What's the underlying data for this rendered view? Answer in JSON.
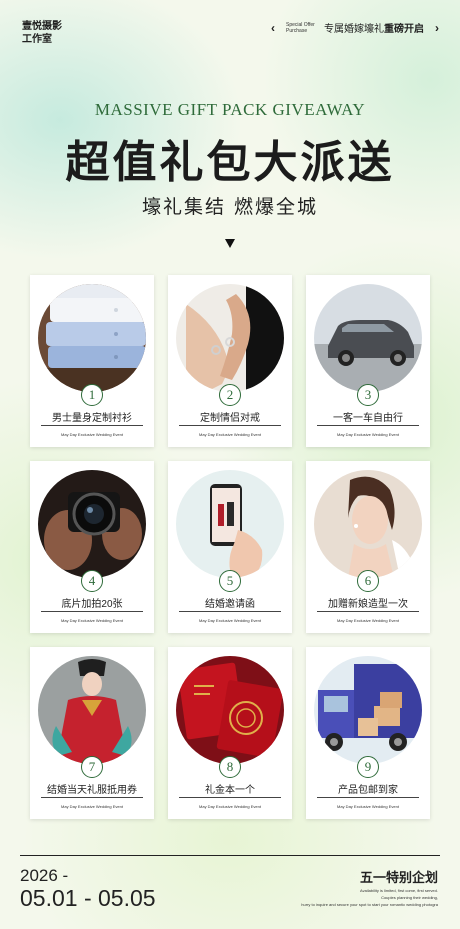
{
  "brand": {
    "line1": "壹悦摄影",
    "line2": "工作室"
  },
  "promo_bar": {
    "prev_icon": "chevron-left-icon",
    "small_line1": "Special Offer",
    "small_line2": "Purchase",
    "promo_prefix": "专属婚嫁壕礼",
    "promo_bold": "重磅开启",
    "next_icon": "chevron-right-icon"
  },
  "hero": {
    "subtitle_en": "MASSIVE GIFT PACK GIVEAWAY",
    "title": "超值礼包大派送",
    "tagline": "壕礼集结 燃爆全城"
  },
  "gifts": [
    {
      "num": "1",
      "label": "男士量身定制衬衫",
      "event": "May Day Exclusive Wedding Event",
      "photo": "folded-shirts"
    },
    {
      "num": "2",
      "label": "定制情侣对戒",
      "event": "May Day Exclusive Wedding Event",
      "photo": "couple-rings"
    },
    {
      "num": "3",
      "label": "一客一车自由行",
      "event": "May Day Exclusive Wedding Event",
      "photo": "suv-car"
    },
    {
      "num": "4",
      "label": "底片加拍20张",
      "event": "May Day Exclusive Wedding Event",
      "photo": "camera"
    },
    {
      "num": "5",
      "label": "结婚邀请函",
      "event": "May Day Exclusive Wedding Event",
      "photo": "phone-invitation"
    },
    {
      "num": "6",
      "label": "加赠新娘造型一次",
      "event": "May Day Exclusive Wedding Event",
      "photo": "bride-portrait"
    },
    {
      "num": "7",
      "label": "结婚当天礼服抵用券",
      "event": "May Day Exclusive Wedding Event",
      "photo": "red-wedding-gown"
    },
    {
      "num": "8",
      "label": "礼金本一个",
      "event": "May Day Exclusive Wedding Event",
      "photo": "red-gift-book"
    },
    {
      "num": "9",
      "label": "产品包邮到家",
      "event": "May Day Exclusive Wedding Event",
      "photo": "delivery-truck"
    }
  ],
  "footer": {
    "year": "2026 -",
    "dates": "05.01 - 05.05",
    "plan": "五一特别企划",
    "notes": [
      "Availability is limited, first come, first served.",
      "Couples planning their wedding,",
      "hurry to inquire and secure your spot to start your romantic wedding photogra"
    ]
  },
  "colors": {
    "accent_green": "#2f6b3a",
    "card_bg": "#ffffff",
    "text_dark": "#222222"
  }
}
